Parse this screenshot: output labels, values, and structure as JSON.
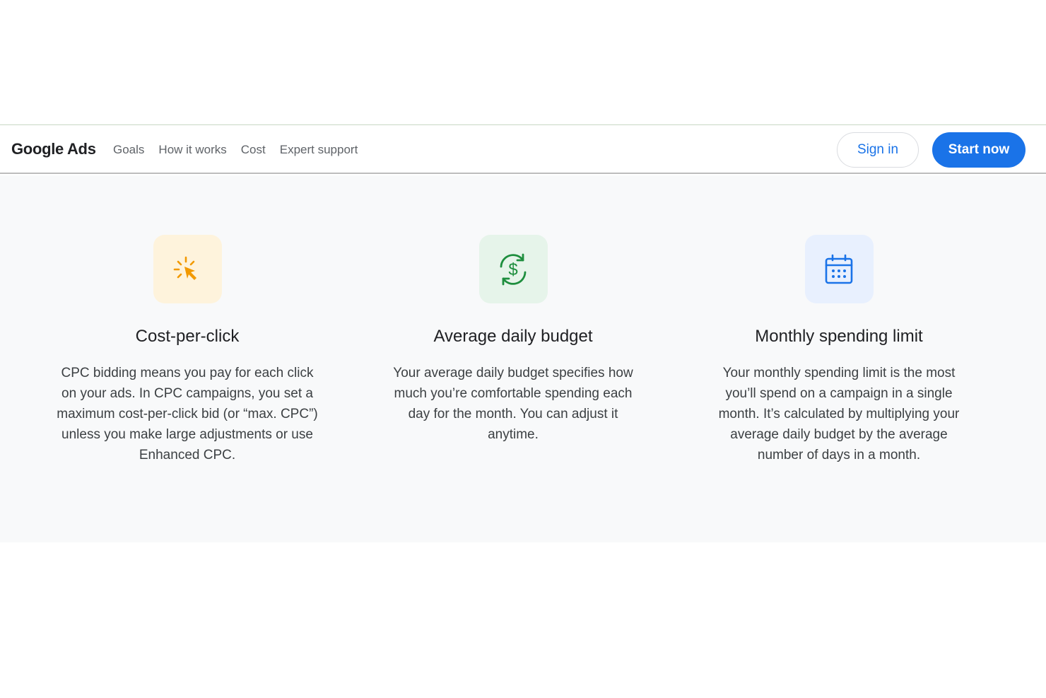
{
  "header": {
    "logo": "Google Ads",
    "nav": [
      "Goals",
      "How it works",
      "Cost",
      "Expert support"
    ],
    "sign_in": "Sign in",
    "start_now": "Start now"
  },
  "cards": [
    {
      "icon": "cursor-click-icon",
      "title": "Cost-per-click",
      "body": "CPC bidding means you pay for each click on your ads. In CPC campaigns, you set a maximum cost-per-click bid (or “max. CPC”) unless you make large adjustments or use Enhanced CPC."
    },
    {
      "icon": "dollar-cycle-icon",
      "title": "Average daily budget",
      "body": "Your average daily budget specifies how much you’re comfortable spending each day for the month. You can adjust it anytime."
    },
    {
      "icon": "calendar-icon",
      "title": "Monthly spending limit",
      "body": "Your monthly spending limit is the most you’ll spend on a campaign in a single month. It’s calculated by multiplying your average daily budget by the average number of days in a month."
    }
  ],
  "colors": {
    "accent_blue": "#1a73e8",
    "icon_yellow": "#f29900",
    "icon_green": "#1e8e3e",
    "section_bg": "#f8f9fa"
  }
}
